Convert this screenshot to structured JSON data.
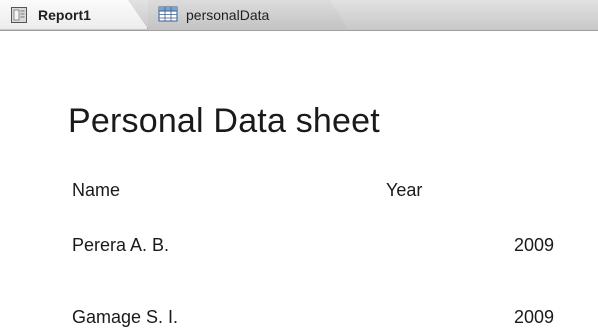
{
  "tabs": [
    {
      "label": "Report1",
      "icon": "report-icon",
      "active": true
    },
    {
      "label": "personalData",
      "icon": "table-icon",
      "active": false
    }
  ],
  "report": {
    "title": "Personal Data sheet",
    "columns": {
      "name": "Name",
      "year": "Year"
    },
    "rows": [
      {
        "name": "Perera A. B.",
        "year": "2009"
      },
      {
        "name": "Gamage S. I.",
        "year": "2009"
      }
    ]
  }
}
